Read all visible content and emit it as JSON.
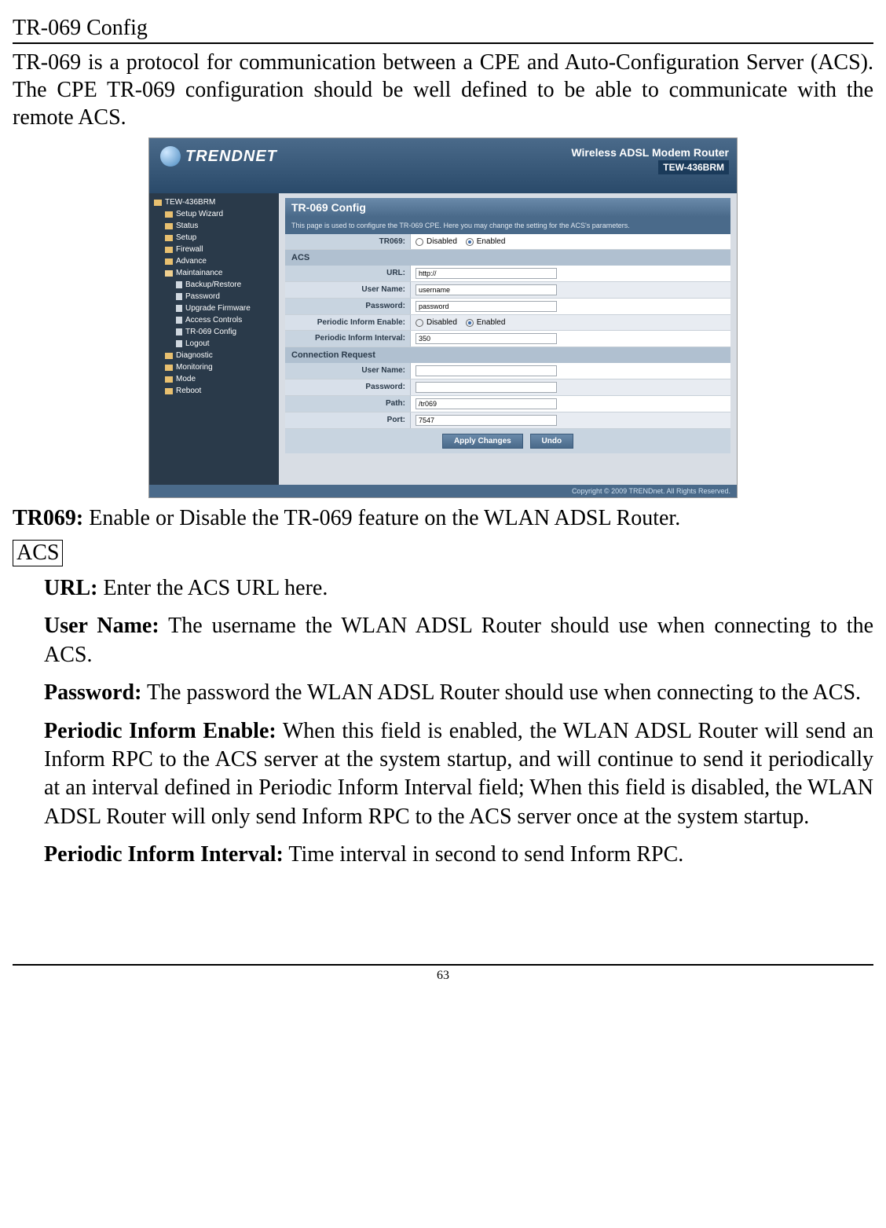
{
  "page": {
    "title": "TR-069 Config",
    "intro": "TR-069 is a protocol for communication between a CPE and Auto-Configuration Server (ACS). The CPE TR-069 configuration should be well defined to be able to communicate with the remote ACS.",
    "number": "63"
  },
  "screenshot": {
    "brand": "TRENDNET",
    "header_line1": "Wireless ADSL Modem Router",
    "header_line2": "TEW-436BRM",
    "nav": {
      "root": "TEW-436BRM",
      "items": [
        "Setup Wizard",
        "Status",
        "Setup",
        "Firewall",
        "Advance",
        "Maintainance"
      ],
      "sub": [
        "Backup/Restore",
        "Password",
        "Upgrade Firmware",
        "Access Controls",
        "TR-069 Config",
        "Logout"
      ],
      "items2": [
        "Diagnostic",
        "Monitoring",
        "Mode",
        "Reboot"
      ]
    },
    "panel": {
      "title": "TR-069 Config",
      "desc": "This page is used to configure the TR-069 CPE. Here you may change the setting for the ACS's parameters.",
      "tr069_label": "TR069:",
      "disabled": "Disabled",
      "enabled": "Enabled",
      "acs_section": "ACS",
      "url_label": "URL:",
      "url_value": "http://",
      "user_label": "User Name:",
      "user_value": "username",
      "pass_label": "Password:",
      "pass_value": "password",
      "pie_label": "Periodic Inform Enable:",
      "pii_label": "Periodic Inform Interval:",
      "pii_value": "350",
      "cr_section": "Connection Request",
      "cr_user_label": "User Name:",
      "cr_user_value": "",
      "cr_pass_label": "Password:",
      "cr_pass_value": "",
      "path_label": "Path:",
      "path_value": "/tr069",
      "port_label": "Port:",
      "port_value": "7547",
      "apply": "Apply Changes",
      "undo": "Undo"
    },
    "footer": "Copyright © 2009 TRENDnet. All Rights Reserved."
  },
  "doc": {
    "tr069_b": "TR069:",
    "tr069_t": " Enable or Disable the TR-069 feature on the WLAN ADSL Router.",
    "acs_box": "ACS",
    "url_b": "URL:",
    "url_t": " Enter the ACS URL here.",
    "user_b": "User Name:",
    "user_t": " The username the WLAN ADSL Router should use when connecting to the ACS.",
    "pass_b": "Password:",
    "pass_t": " The password the WLAN ADSL Router should use when connecting to the ACS.",
    "pie_b": "Periodic Inform Enable:",
    "pie_t": " When this field is enabled, the WLAN ADSL Router will send an Inform RPC to the ACS server at the system startup, and will continue to send it periodically at an interval defined in Periodic Inform Interval field; When this field is disabled, the WLAN ADSL Router will only send Inform RPC to the ACS server once at the system startup.",
    "pii_b": "Periodic Inform Interval:",
    "pii_t": " Time interval in second to send Inform RPC."
  }
}
